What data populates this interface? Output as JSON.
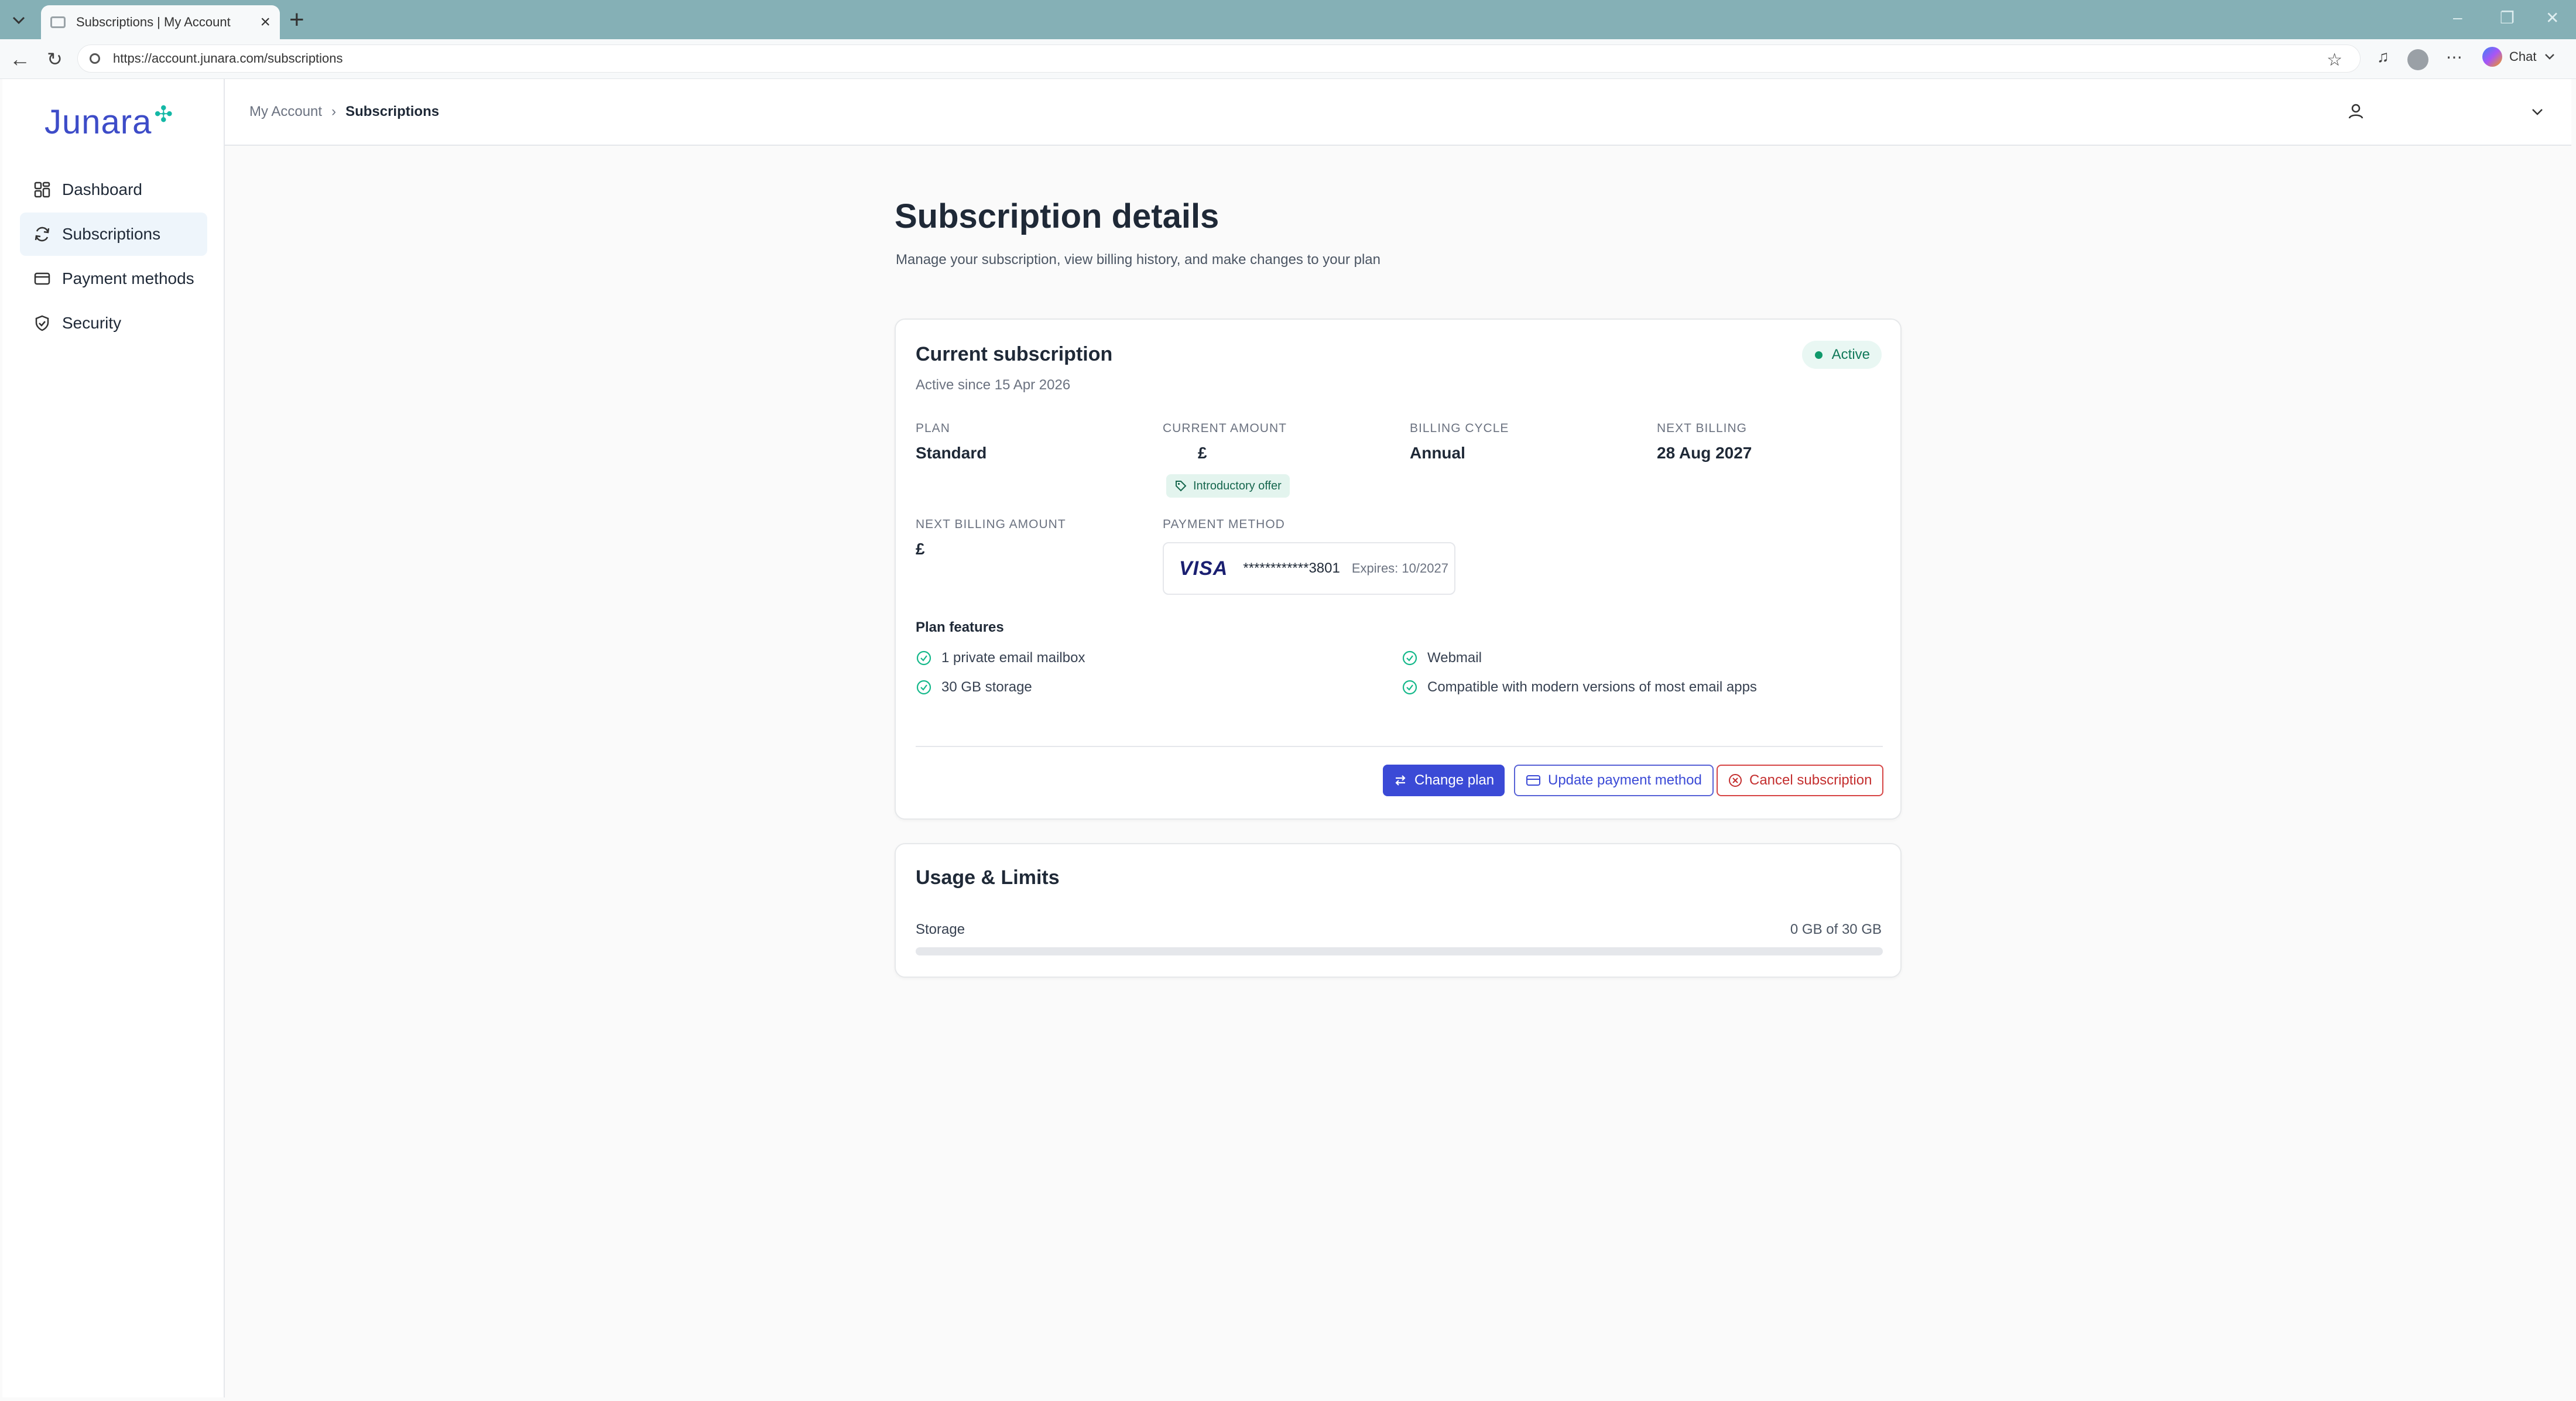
{
  "browser": {
    "tab_title": "Subscriptions | My Account",
    "url": "https://account.junara.com/subscriptions",
    "chat_label": "Chat"
  },
  "brand": {
    "name": "Junara"
  },
  "sidebar": {
    "items": [
      {
        "label": "Dashboard",
        "icon": "dashboard-icon"
      },
      {
        "label": "Subscriptions",
        "icon": "refresh-icon"
      },
      {
        "label": "Payment methods",
        "icon": "credit-card-icon"
      },
      {
        "label": "Security",
        "icon": "shield-icon"
      }
    ],
    "active": "Subscriptions"
  },
  "breadcrumb": {
    "root": "My Account",
    "current": "Subscriptions"
  },
  "page": {
    "title": "Subscription details",
    "subtitle": "Manage your subscription, view billing history, and make changes to your plan"
  },
  "subscription": {
    "title": "Current subscription",
    "since": "Active since 15 Apr 2026",
    "status": "Active",
    "plan_label": "PLAN",
    "plan": "Standard",
    "amount_label": "CURRENT AMOUNT",
    "amount": "£",
    "offer": "Introductory offer",
    "cycle_label": "BILLING CYCLE",
    "cycle": "Annual",
    "next_billing_label": "NEXT BILLING",
    "next_billing": "28 Aug 2027",
    "next_amount_label": "NEXT BILLING AMOUNT",
    "next_amount": "£",
    "payment_label": "PAYMENT METHOD",
    "card_brand": "VISA",
    "card_number": "************3801",
    "card_expires": "Expires: 10/2027",
    "features_title": "Plan features",
    "features": [
      "1 private email mailbox",
      "30 GB storage",
      "Webmail",
      "Compatible with modern versions of most email apps"
    ],
    "actions": {
      "change_plan": "Change plan",
      "update_payment": "Update payment method",
      "cancel": "Cancel subscription"
    }
  },
  "usage": {
    "title": "Usage & Limits",
    "storage_label": "Storage",
    "storage_value": "0 GB of 30 GB",
    "storage_used_fraction": 0
  },
  "colors": {
    "brand": "#3d4cc8",
    "accent": "#14b8a6",
    "primary_button": "#3b4ad6",
    "danger": "#c42f2f",
    "status_green": "#10996b"
  }
}
